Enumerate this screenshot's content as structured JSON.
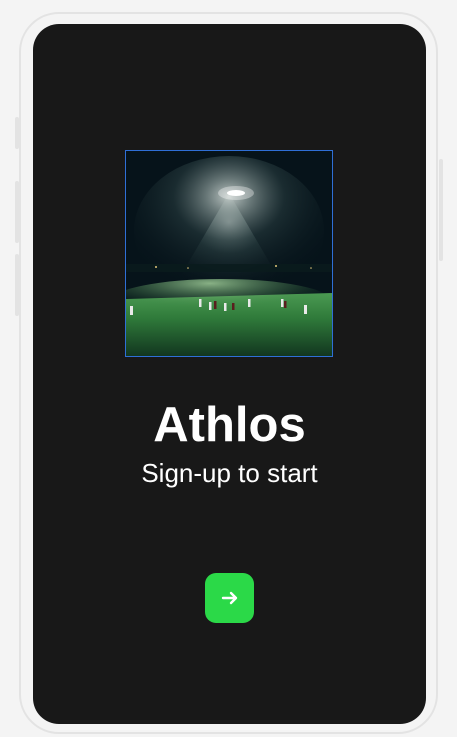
{
  "app": {
    "title": "Athlos",
    "subtitle": "Sign-up to start"
  },
  "hero_image": {
    "description_icon": "night-football-field-photo"
  },
  "actions": {
    "next_icon": "arrow-right-icon"
  },
  "colors": {
    "screen_bg": "#181818",
    "accent": "#2bd948",
    "image_border": "#2f6fd6",
    "text": "#ffffff"
  }
}
